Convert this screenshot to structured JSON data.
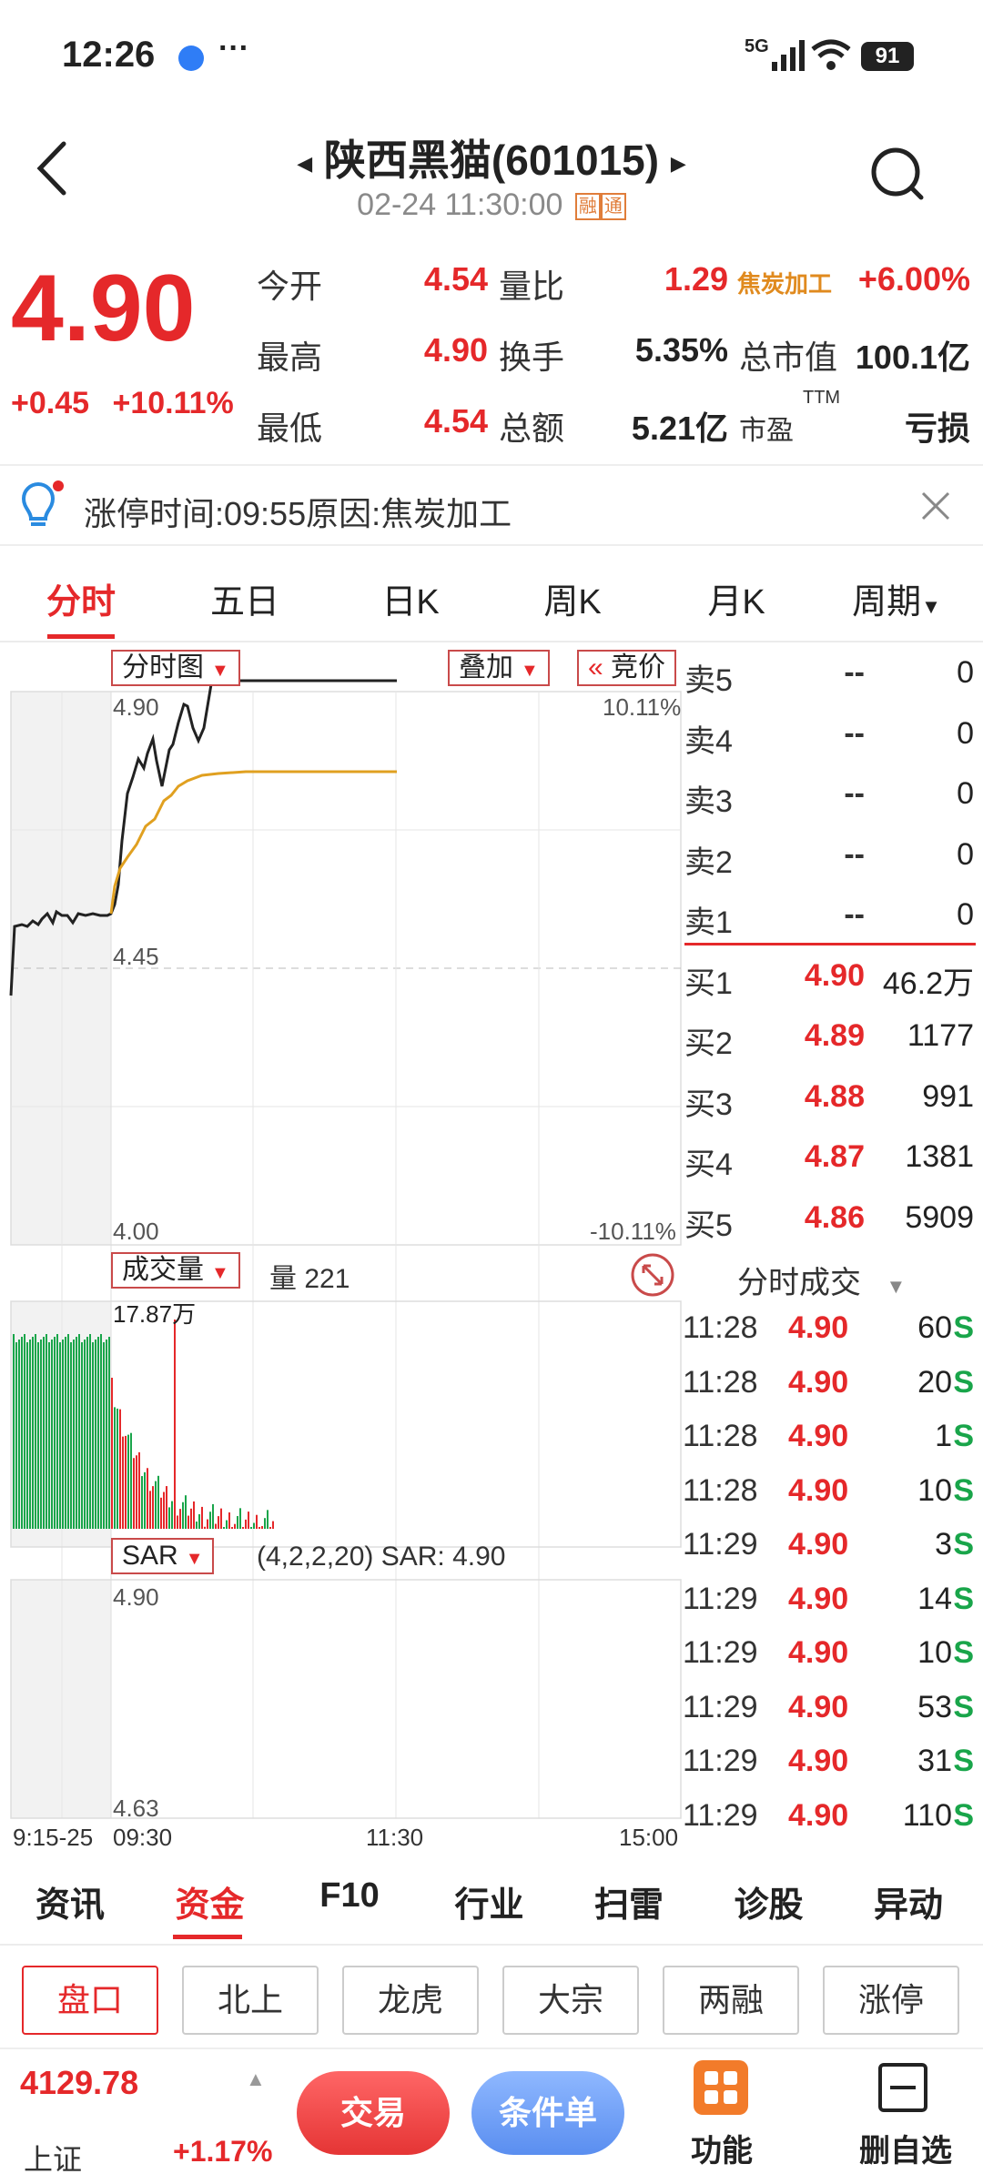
{
  "status": {
    "time": "12:26",
    "more": "···",
    "network": "5G",
    "battery": "91"
  },
  "header": {
    "title": "陕西黑猫(601015)",
    "datetime": "02-24 11:30:00",
    "tag1": "融",
    "tag2": "通"
  },
  "quote": {
    "price": "4.90",
    "change": "+0.45",
    "change_pct": "+10.11%",
    "fields": [
      {
        "label": "今开",
        "value": "4.54"
      },
      {
        "label": "最高",
        "value": "4.90"
      },
      {
        "label": "最低",
        "value": "4.54"
      },
      {
        "label": "量比",
        "value": "1.29"
      },
      {
        "label": "换手",
        "value": "5.35%"
      },
      {
        "label": "总额",
        "value": "5.21亿"
      },
      {
        "label": "焦炭加工",
        "value": "+6.00%"
      },
      {
        "label": "总市值",
        "value": "100.1亿"
      },
      {
        "label": "市盈",
        "sup": "TTM",
        "value": "亏损"
      }
    ]
  },
  "notice": {
    "text": "涨停时间:09:55原因:焦炭加工"
  },
  "tabs": [
    "分时",
    "五日",
    "日K",
    "周K",
    "月K",
    "周期"
  ],
  "chart": {
    "main_dropdown": "分时图",
    "overlay_dropdown": "叠加",
    "auction_button": "竞价",
    "y_top": "4.90",
    "y_mid": "4.45",
    "y_bottom": "4.00",
    "pct_top": "10.11%",
    "pct_bottom": "-10.11%",
    "vol_dropdown": "成交量",
    "vol_label": "量 221",
    "vol_max": "17.87万",
    "ind_dropdown": "SAR",
    "ind_label": "(4,2,2,20) SAR: 4.90",
    "ind_top": "4.90",
    "ind_bottom": "4.63",
    "x_labels": [
      "9:15-25",
      "09:30",
      "11:30",
      "15:00"
    ]
  },
  "order_book": {
    "sell": [
      {
        "label": "卖5",
        "price": "--",
        "vol": "0"
      },
      {
        "label": "卖4",
        "price": "--",
        "vol": "0"
      },
      {
        "label": "卖3",
        "price": "--",
        "vol": "0"
      },
      {
        "label": "卖2",
        "price": "--",
        "vol": "0"
      },
      {
        "label": "卖1",
        "price": "--",
        "vol": "0"
      }
    ],
    "buy": [
      {
        "label": "买1",
        "price": "4.90",
        "vol": "46.2万"
      },
      {
        "label": "买2",
        "price": "4.89",
        "vol": "1177"
      },
      {
        "label": "买3",
        "price": "4.88",
        "vol": "991"
      },
      {
        "label": "买4",
        "price": "4.87",
        "vol": "1381"
      },
      {
        "label": "买5",
        "price": "4.86",
        "vol": "5909"
      }
    ]
  },
  "ticks": {
    "title": "分时成交",
    "rows": [
      {
        "time": "11:28",
        "price": "4.90",
        "vol": "60",
        "side": "S"
      },
      {
        "time": "11:28",
        "price": "4.90",
        "vol": "20",
        "side": "S"
      },
      {
        "time": "11:28",
        "price": "4.90",
        "vol": "1",
        "side": "S"
      },
      {
        "time": "11:28",
        "price": "4.90",
        "vol": "10",
        "side": "S"
      },
      {
        "time": "11:29",
        "price": "4.90",
        "vol": "3",
        "side": "S"
      },
      {
        "time": "11:29",
        "price": "4.90",
        "vol": "14",
        "side": "S"
      },
      {
        "time": "11:29",
        "price": "4.90",
        "vol": "10",
        "side": "S"
      },
      {
        "time": "11:29",
        "price": "4.90",
        "vol": "53",
        "side": "S"
      },
      {
        "time": "11:29",
        "price": "4.90",
        "vol": "31",
        "side": "S"
      },
      {
        "time": "11:29",
        "price": "4.90",
        "vol": "110",
        "side": "S"
      }
    ]
  },
  "bottom_tabs": [
    "资讯",
    "资金",
    "F10",
    "行业",
    "扫雷",
    "诊股",
    "异动"
  ],
  "chips": [
    "盘口",
    "北上",
    "龙虎",
    "大宗",
    "两融",
    "涨停"
  ],
  "footer": {
    "index_value": "4129.78",
    "index_name": "上证",
    "index_change": "+1.17%",
    "trade": "交易",
    "condition": "条件单",
    "func": "功能",
    "del_fav": "删自选"
  },
  "colors": {
    "up": "#e5282a",
    "down": "#19a54a",
    "avg_line": "#e0a020"
  }
}
